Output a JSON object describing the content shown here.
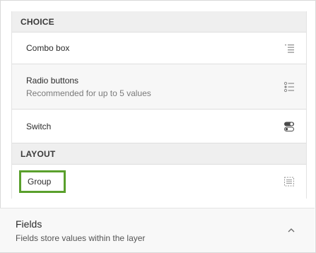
{
  "choice_section": {
    "header": "CHOICE",
    "items": [
      {
        "label": "Combo box",
        "icon": "list-icon"
      },
      {
        "label": "Radio buttons",
        "sublabel": "Recommended for up to 5 values",
        "icon": "radio-list-icon"
      },
      {
        "label": "Switch",
        "icon": "toggle-switch-icon"
      }
    ]
  },
  "layout_section": {
    "header": "LAYOUT",
    "items": [
      {
        "label": "Group",
        "icon": "group-icon",
        "highlight_color": "#5aa02c"
      }
    ]
  },
  "fields_panel": {
    "title": "Fields",
    "description": "Fields store values within the layer",
    "icon": "chevron-up-icon"
  }
}
